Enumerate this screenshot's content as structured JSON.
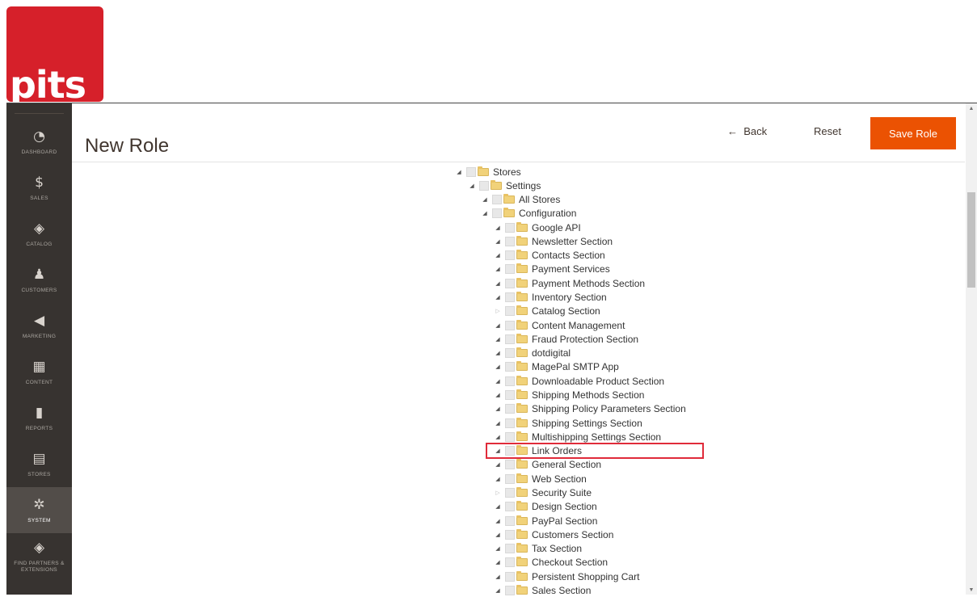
{
  "logo": {
    "text": "pits"
  },
  "sidebar": {
    "items": [
      {
        "label": "Dashboard",
        "icon": "dashboard-icon",
        "glyph": "◔"
      },
      {
        "label": "Sales",
        "icon": "dollar-icon",
        "glyph": "$"
      },
      {
        "label": "Catalog",
        "icon": "cube-icon",
        "glyph": "◈"
      },
      {
        "label": "Customers",
        "icon": "person-icon",
        "glyph": "♟"
      },
      {
        "label": "Marketing",
        "icon": "megaphone-icon",
        "glyph": "◀"
      },
      {
        "label": "Content",
        "icon": "layout-icon",
        "glyph": "▦"
      },
      {
        "label": "Reports",
        "icon": "bar-chart-icon",
        "glyph": "▮"
      },
      {
        "label": "Stores",
        "icon": "store-icon",
        "glyph": "▤"
      },
      {
        "label": "System",
        "icon": "gear-icon",
        "glyph": "✲"
      },
      {
        "label": "Find Partners & Extensions",
        "icon": "box-icon",
        "glyph": "◈"
      }
    ]
  },
  "header": {
    "title": "New Role",
    "back_label": "Back",
    "back_arrow": "←",
    "reset_label": "Reset",
    "save_label": "Save Role"
  },
  "tree": [
    {
      "label": "Stores",
      "level": 0,
      "expanded": true
    },
    {
      "label": "Settings",
      "level": 1,
      "expanded": true
    },
    {
      "label": "All Stores",
      "level": 2,
      "expanded": true
    },
    {
      "label": "Configuration",
      "level": 2,
      "expanded": true
    },
    {
      "label": "Google API",
      "level": 3,
      "expanded": true
    },
    {
      "label": "Newsletter Section",
      "level": 3,
      "expanded": true
    },
    {
      "label": "Contacts Section",
      "level": 3,
      "expanded": true
    },
    {
      "label": "Payment Services",
      "level": 3,
      "expanded": true
    },
    {
      "label": "Payment Methods Section",
      "level": 3,
      "expanded": true
    },
    {
      "label": "Inventory Section",
      "level": 3,
      "expanded": true
    },
    {
      "label": "Catalog Section",
      "level": 3,
      "expanded": false
    },
    {
      "label": "Content Management",
      "level": 3,
      "expanded": true
    },
    {
      "label": "Fraud Protection Section",
      "level": 3,
      "expanded": true
    },
    {
      "label": "dotdigital",
      "level": 3,
      "expanded": true
    },
    {
      "label": "MagePal SMTP App",
      "level": 3,
      "expanded": true
    },
    {
      "label": "Downloadable Product Section",
      "level": 3,
      "expanded": true
    },
    {
      "label": "Shipping Methods Section",
      "level": 3,
      "expanded": true
    },
    {
      "label": "Shipping Policy Parameters Section",
      "level": 3,
      "expanded": true
    },
    {
      "label": "Shipping Settings Section",
      "level": 3,
      "expanded": true
    },
    {
      "label": "Multishipping Settings Section",
      "level": 3,
      "expanded": true
    },
    {
      "label": "Link Orders",
      "level": 3,
      "expanded": true,
      "highlighted": true
    },
    {
      "label": "General Section",
      "level": 3,
      "expanded": true
    },
    {
      "label": "Web Section",
      "level": 3,
      "expanded": true
    },
    {
      "label": "Security Suite",
      "level": 3,
      "expanded": false
    },
    {
      "label": "Design Section",
      "level": 3,
      "expanded": true
    },
    {
      "label": "PayPal Section",
      "level": 3,
      "expanded": true
    },
    {
      "label": "Customers Section",
      "level": 3,
      "expanded": true
    },
    {
      "label": "Tax Section",
      "level": 3,
      "expanded": true
    },
    {
      "label": "Checkout Section",
      "level": 3,
      "expanded": true
    },
    {
      "label": "Persistent Shopping Cart",
      "level": 3,
      "expanded": true
    },
    {
      "label": "Sales Section",
      "level": 3,
      "expanded": true
    }
  ],
  "colors": {
    "accent": "#eb5202",
    "sidebar_bg": "#373330",
    "highlight_border": "#e02b3a",
    "logo_bg": "#d6202a"
  }
}
